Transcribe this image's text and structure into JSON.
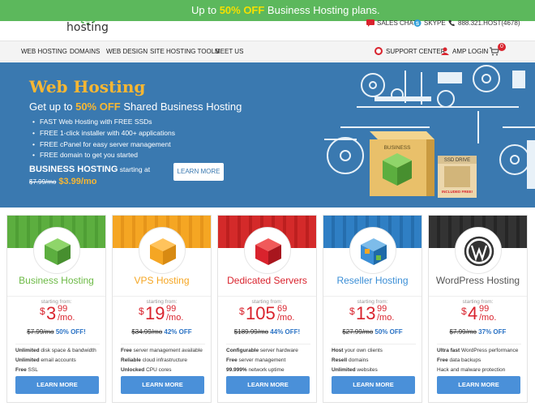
{
  "promo": {
    "text_prefix": "Up to ",
    "text_highlight": "50% OFF",
    "text_suffix": " Business Hosting plans."
  },
  "header": {
    "logo_text": "hosting",
    "sales_chat": "SALES CHAT",
    "skype": "SKYPE",
    "phone": "888.321.HOST(4678)"
  },
  "nav": {
    "items": [
      "WEB HOSTING",
      "DOMAINS",
      "WEB DESIGN",
      "SITE HOSTING TOOLS",
      "MEET US"
    ],
    "support": "SUPPORT CENTER",
    "login": "AMP LOGIN",
    "cart_count": "0"
  },
  "hero": {
    "title": "Web Hosting",
    "subtitle_prefix": "Get up to ",
    "subtitle_highlight": "50% OFF",
    "subtitle_suffix": " Shared Business Hosting",
    "features": [
      "FAST Web Hosting with FREE SSDs",
      "FREE 1-click installer with 400+ applications",
      "FREE cPanel for easy server management",
      "FREE domain to get you started"
    ],
    "plan_name": "BUSINESS HOSTING",
    "plan_suffix": " starting at",
    "old_price": "$7.99/mo",
    "new_price": "$3.99/mo",
    "button": "LEARN MORE",
    "box_label": "BUSINESS",
    "ssd_label": "SSD DRIVE",
    "ssd_badge": "INCLUDED FREE!"
  },
  "plans": [
    {
      "name": "Business Hosting",
      "color": "#6cba45",
      "top": "#5cae3f",
      "starting": "starting from:",
      "currency": "$",
      "int": "3",
      "cents": "99",
      "per": "/mo.",
      "old": "$7.99/mo",
      "save": "50% OFF!",
      "features": [
        [
          "Unlimited",
          " disk space & bandwidth"
        ],
        [
          "Unlimited",
          " email accounts"
        ],
        [
          "Free",
          " SSL"
        ]
      ],
      "button": "LEARN MORE"
    },
    {
      "name": "VPS Hosting",
      "color": "#f5a623",
      "top": "#f5a623",
      "starting": "starting from:",
      "currency": "$",
      "int": "19",
      "cents": "99",
      "per": "/mo.",
      "old": "$34.99/mo",
      "save": "42% OFF",
      "features": [
        [
          "Free",
          " server management available"
        ],
        [
          "Reliable",
          " cloud infrastructure"
        ],
        [
          "Unlocked",
          " CPU cores"
        ]
      ],
      "button": "LEARN MORE"
    },
    {
      "name": "Dedicated Servers",
      "color": "#d9232d",
      "top": "#d42a2a",
      "starting": "starting from:",
      "currency": "$",
      "int": "105",
      "cents": "69",
      "per": "/mo.",
      "old": "$189.99/mo",
      "save": "44% OFF!",
      "features": [
        [
          "Configurable",
          " server hardware"
        ],
        [
          "Free",
          " server management"
        ],
        [
          "99.999%",
          " network uptime"
        ]
      ],
      "button": "LEARN MORE"
    },
    {
      "name": "Reseller Hosting",
      "color": "#3a8ed6",
      "top": "#2f7fc4",
      "starting": "starting from:",
      "currency": "$",
      "int": "13",
      "cents": "99",
      "per": "/mo.",
      "old": "$27.99/mo",
      "save": "50% OFF",
      "features": [
        [
          "Host",
          " your own clients"
        ],
        [
          "Resell",
          " domains"
        ],
        [
          "Unlimited",
          " websites"
        ]
      ],
      "button": "LEARN MORE"
    },
    {
      "name": "WordPress Hosting",
      "color": "#555555",
      "top": "#333333",
      "starting": "starting from:",
      "currency": "$",
      "int": "4",
      "cents": "99",
      "per": "/mo.",
      "old": "$7.99/mo",
      "save": "37% OFF",
      "features": [
        [
          "Ultra fast",
          " WordPress performance"
        ],
        [
          "Free",
          " data backups"
        ],
        [
          "Hack and malware protection",
          ""
        ]
      ],
      "button": "LEARN MORE"
    }
  ],
  "colors": {
    "promo": "#5cb85c",
    "hero": "#3a79b0",
    "accent": "#f7b733",
    "price": "#d9232d",
    "button": "#4a90d9"
  }
}
